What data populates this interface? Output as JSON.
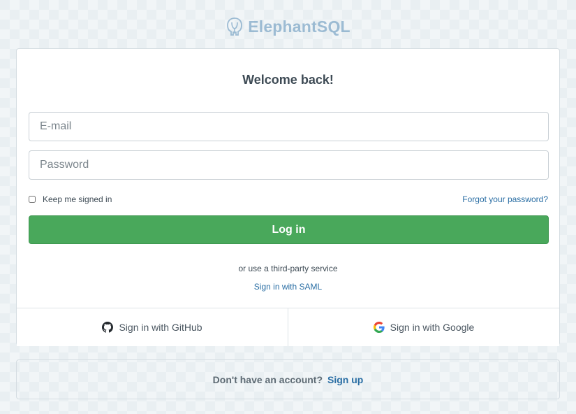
{
  "brand": {
    "name": "ElephantSQL",
    "icon": "elephant-logo-icon",
    "color": "#5a8fb8"
  },
  "login": {
    "title": "Welcome back!",
    "email_placeholder": "E-mail",
    "email_value": "",
    "password_placeholder": "Password",
    "password_value": "",
    "remember_label": "Keep me signed in",
    "remember_checked": false,
    "forgot_label": "Forgot your password?",
    "submit_label": "Log in"
  },
  "third_party": {
    "caption": "or use a third-party service",
    "saml_label": "Sign in with SAML",
    "github_label": "Sign in with GitHub",
    "github_icon": "github-icon",
    "google_label": "Sign in with Google",
    "google_icon": "google-icon"
  },
  "signup": {
    "prompt": "Don't have an account?",
    "link_label": "Sign up"
  },
  "colors": {
    "primary_button": "#49a85b",
    "link": "#2a6ea4",
    "background": "#e9eff2"
  }
}
